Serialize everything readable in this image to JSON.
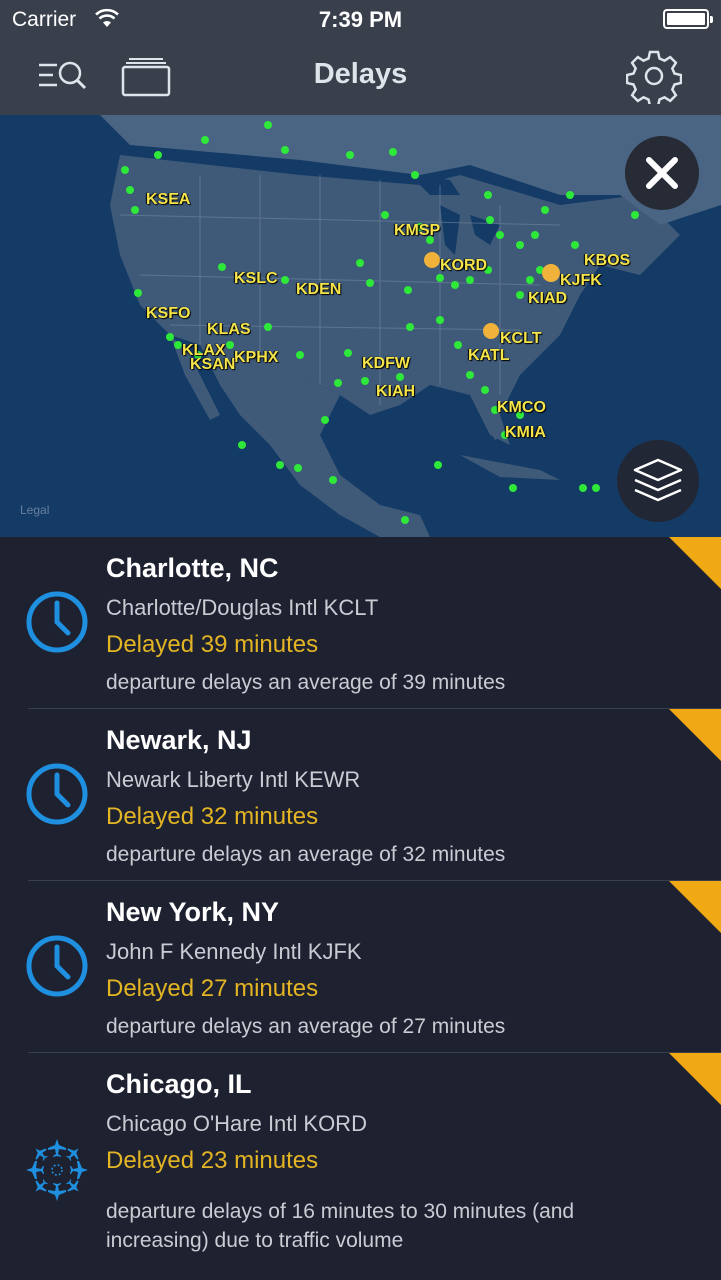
{
  "status_bar": {
    "carrier": "Carrier",
    "time": "7:39 PM"
  },
  "nav": {
    "title": "Delays"
  },
  "map": {
    "logo_text": "Legal",
    "airports": [
      {
        "code": "KSEA"
      },
      {
        "code": "KMSP"
      },
      {
        "code": "KORD"
      },
      {
        "code": "KBOS"
      },
      {
        "code": "KSLC"
      },
      {
        "code": "KDEN"
      },
      {
        "code": "KJFK"
      },
      {
        "code": "KIAD"
      },
      {
        "code": "KSFO"
      },
      {
        "code": "KLAS"
      },
      {
        "code": "KCLT"
      },
      {
        "code": "KLAX"
      },
      {
        "code": "KPHX"
      },
      {
        "code": "KATL"
      },
      {
        "code": "KSAN"
      },
      {
        "code": "KDFW"
      },
      {
        "code": "KIAH"
      },
      {
        "code": "KMCO"
      },
      {
        "code": "KMIA"
      }
    ]
  },
  "delays": [
    {
      "city": "Charlotte, NC",
      "airport": "Charlotte/Douglas Intl KCLT",
      "status": "Delayed 39 minutes",
      "description": "departure delays an average of 39 minutes",
      "icon": "clock-icon"
    },
    {
      "city": "Newark, NJ",
      "airport": "Newark Liberty Intl KEWR",
      "status": "Delayed 32 minutes",
      "description": "departure delays an average of 32 minutes",
      "icon": "clock-icon"
    },
    {
      "city": "New York, NY",
      "airport": "John F Kennedy Intl KJFK",
      "status": "Delayed 27 minutes",
      "description": "departure delays an average of 27 minutes",
      "icon": "clock-icon"
    },
    {
      "city": "Chicago, IL",
      "airport": "Chicago O'Hare Intl KORD",
      "status": "Delayed 23 minutes",
      "description": "departure delays of 16 minutes to 30 minutes (and increasing) due to traffic volume",
      "icon": "airplanes-icon"
    }
  ],
  "colors": {
    "accent": "#e3b423",
    "flag": "#f0a914",
    "icon_blue": "#1f8fe0",
    "dot_green": "#2ee83a"
  }
}
